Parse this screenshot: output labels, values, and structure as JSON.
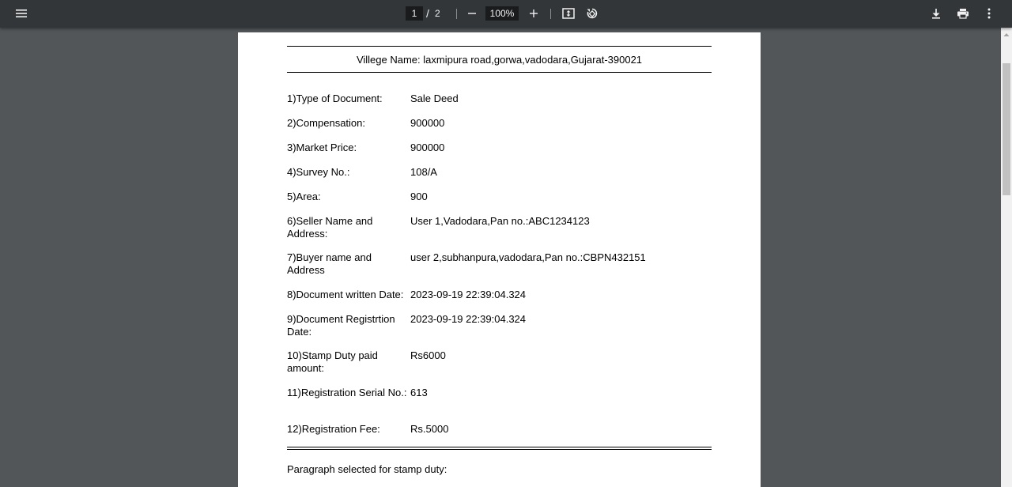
{
  "toolbar": {
    "menu_icon": "hamburger-menu-icon",
    "current_page": "1",
    "page_separator": "/",
    "total_pages": "2",
    "zoom_level": "100%",
    "zoom_out_icon": "minus-icon",
    "zoom_in_icon": "plus-icon",
    "fit_icon": "fit-to-page-icon",
    "rotate_icon": "rotate-icon",
    "download_icon": "download-icon",
    "print_icon": "print-icon",
    "more_icon": "more-vertical-icon",
    "icon_color": "#f1f1f1",
    "background": "#323639"
  },
  "document": {
    "village": "Villege Name: laxmipura road,gorwa,vadodara,Gujarat-390021",
    "fields": [
      {
        "label": "1)Type of Document:",
        "value": "Sale Deed"
      },
      {
        "label": "2)Compensation:",
        "value": "900000"
      },
      {
        "label": "3)Market Price:",
        "value": "900000"
      },
      {
        "label": "4)Survey No.:",
        "value": "108/A"
      },
      {
        "label": "5)Area:",
        "value": "900"
      },
      {
        "label": "6)Seller Name and Address:",
        "value": "User 1,Vadodara,Pan no.:ABC1234123"
      },
      {
        "label": "7)Buyer name and Address",
        "value": "user 2,subhanpura,vadodara,Pan no.:CBPN432151"
      },
      {
        "label": "8)Document written Date:",
        "value": "2023-09-19 22:39:04.324"
      },
      {
        "label": "9)Document Registrtion Date:",
        "value": "2023-09-19 22:39:04.324"
      },
      {
        "label": "10)Stamp Duty paid amount:",
        "value": "Rs6000"
      },
      {
        "label": "11)Registration Serial No.:",
        "value": "613"
      },
      {
        "label": "12)Registration Fee:",
        "value": "Rs.5000"
      }
    ],
    "paragraph_label": "Paragraph selected for stamp duty:"
  },
  "colors": {
    "viewer_background": "#525659",
    "page_background": "#ffffff",
    "scrollbar_track": "#f1f1f1",
    "scrollbar_thumb": "#c1c1c1"
  }
}
